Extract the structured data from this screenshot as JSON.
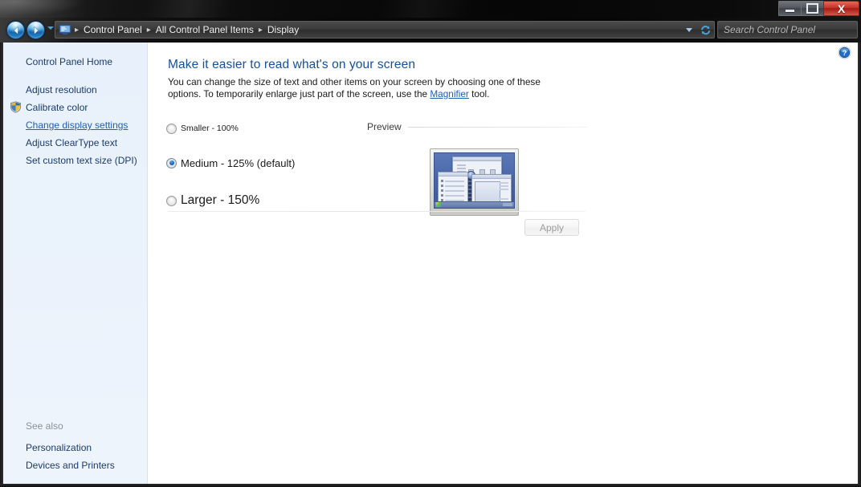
{
  "window": {
    "minimize_label": "Minimize",
    "maximize_label": "Maximize",
    "close_label": "X"
  },
  "navbar": {
    "back_label": "Back",
    "forward_label": "Forward",
    "recent_pages_label": "Recent pages",
    "refresh_label": "Refresh",
    "breadcrumb": [
      "Control Panel",
      "All Control Panel Items",
      "Display"
    ],
    "breadcrumb_separator": "▸",
    "search": {
      "value": "",
      "placeholder": "Search Control Panel"
    }
  },
  "sidebar": {
    "home_label": "Control Panel Home",
    "items": [
      {
        "label": "Adjust resolution",
        "icon": "",
        "state": "normal"
      },
      {
        "label": "Calibrate color",
        "icon": "shield-icon",
        "state": "normal"
      },
      {
        "label": "Change display settings",
        "icon": "",
        "state": "current"
      },
      {
        "label": "Adjust ClearType text",
        "icon": "",
        "state": "normal"
      },
      {
        "label": "Set custom text size (DPI)",
        "icon": "",
        "state": "normal"
      }
    ],
    "see_also_heading": "See also",
    "see_also_items": [
      {
        "label": "Personalization"
      },
      {
        "label": "Devices and Printers"
      }
    ]
  },
  "content": {
    "help_label": "Help",
    "heading": "Make it easier to read what's on your screen",
    "description_part1": "You can change the size of text and other items on your screen by choosing one of these options. To temporarily enlarge just part of the screen, use the ",
    "description_link": "Magnifier",
    "description_part2": " tool.",
    "options": [
      {
        "label": "Smaller - 100%",
        "checked": false,
        "scale": 100
      },
      {
        "label": "Medium - 125% (default)",
        "checked": true,
        "scale": 125
      },
      {
        "label": "Larger - 150%",
        "checked": false,
        "scale": 150
      }
    ],
    "preview_label": "Preview",
    "apply_label": "Apply",
    "apply_enabled": false
  },
  "colors": {
    "heading_blue": "#15509c",
    "link_blue": "#1c5fb5",
    "sidebar_bg": "#e8f1fb",
    "accent_radio": "#1668b8",
    "close_button_red": "#c4342a"
  }
}
